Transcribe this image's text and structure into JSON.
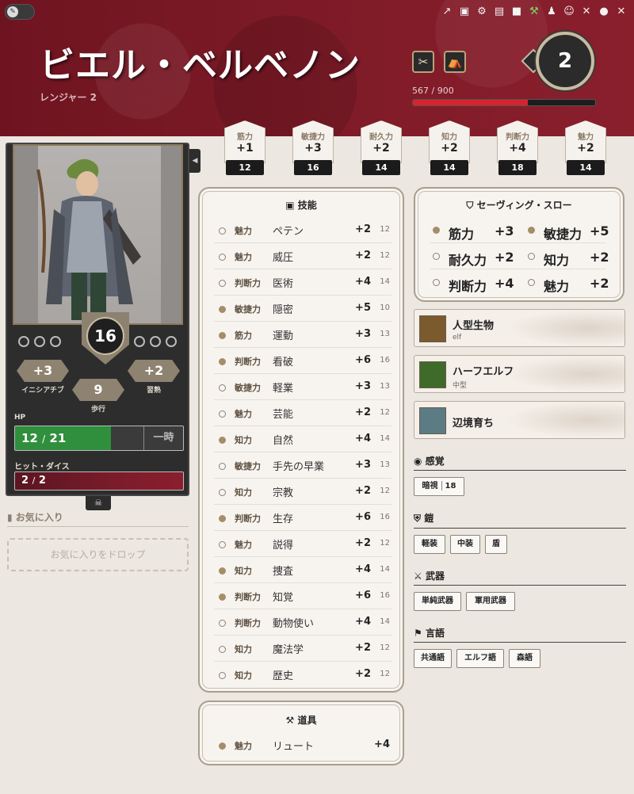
{
  "header": {
    "name": "ビエル・ベルベノン",
    "subclass": "レンジャー 2",
    "xp_text": "567 / 900",
    "xp_fraction": 0.63,
    "level": "2",
    "icons": [
      "external-link-icon",
      "portrait-icon",
      "gear-icon",
      "sheet-icon",
      "chat-icon",
      "wrench-icon",
      "user-edit-icon",
      "mask-icon",
      "tools-icon",
      "account-icon",
      "close-icon"
    ],
    "rest_icons": [
      "short-rest-icon",
      "long-rest-icon"
    ]
  },
  "abilities": [
    {
      "abbr": "筋力",
      "mod": "+1",
      "score": "12"
    },
    {
      "abbr": "敏捷力",
      "mod": "+3",
      "score": "16"
    },
    {
      "abbr": "耐久力",
      "mod": "+2",
      "score": "14"
    },
    {
      "abbr": "知力",
      "mod": "+2",
      "score": "14"
    },
    {
      "abbr": "判断力",
      "mod": "+4",
      "score": "18"
    },
    {
      "abbr": "魅力",
      "mod": "+2",
      "score": "14"
    }
  ],
  "sidebar": {
    "ac": "16",
    "initiative": {
      "value": "+3",
      "label": "イニシアチブ"
    },
    "proficiency": {
      "value": "+2",
      "label": "習熟"
    },
    "speed": {
      "value": "9",
      "label": "歩行"
    },
    "hp": {
      "label": "HP",
      "value": "12",
      "max": "21",
      "temp_label": "一時",
      "fraction": 0.571
    },
    "hit_dice": {
      "label": "ヒット・ダイス",
      "value": "2",
      "max": "2"
    },
    "favorites": {
      "title": "お気に入り",
      "drop": "お気に入りをドロップ"
    }
  },
  "skills": {
    "title": "技能",
    "rows": [
      {
        "abil": "魅力",
        "name": "ペテン",
        "mod": "+2",
        "passive": "12",
        "prof": false
      },
      {
        "abil": "魅力",
        "name": "威圧",
        "mod": "+2",
        "passive": "12",
        "prof": false
      },
      {
        "abil": "判断力",
        "name": "医術",
        "mod": "+4",
        "passive": "14",
        "prof": false
      },
      {
        "abil": "敏捷力",
        "name": "隠密",
        "mod": "+5",
        "passive": "10",
        "prof": true
      },
      {
        "abil": "筋力",
        "name": "運動",
        "mod": "+3",
        "passive": "13",
        "prof": true
      },
      {
        "abil": "判断力",
        "name": "看破",
        "mod": "+6",
        "passive": "16",
        "prof": true
      },
      {
        "abil": "敏捷力",
        "name": "軽業",
        "mod": "+3",
        "passive": "13",
        "prof": false
      },
      {
        "abil": "魅力",
        "name": "芸能",
        "mod": "+2",
        "passive": "12",
        "prof": false
      },
      {
        "abil": "知力",
        "name": "自然",
        "mod": "+4",
        "passive": "14",
        "prof": true
      },
      {
        "abil": "敏捷力",
        "name": "手先の早業",
        "mod": "+3",
        "passive": "13",
        "prof": false
      },
      {
        "abil": "知力",
        "name": "宗教",
        "mod": "+2",
        "passive": "12",
        "prof": false
      },
      {
        "abil": "判断力",
        "name": "生存",
        "mod": "+6",
        "passive": "16",
        "prof": true
      },
      {
        "abil": "魅力",
        "name": "説得",
        "mod": "+2",
        "passive": "12",
        "prof": false
      },
      {
        "abil": "知力",
        "name": "捜査",
        "mod": "+4",
        "passive": "14",
        "prof": true
      },
      {
        "abil": "判断力",
        "name": "知覚",
        "mod": "+6",
        "passive": "16",
        "prof": true
      },
      {
        "abil": "判断力",
        "name": "動物使い",
        "mod": "+4",
        "passive": "14",
        "prof": false
      },
      {
        "abil": "知力",
        "name": "魔法学",
        "mod": "+2",
        "passive": "12",
        "prof": false
      },
      {
        "abil": "知力",
        "name": "歴史",
        "mod": "+2",
        "passive": "12",
        "prof": false
      }
    ]
  },
  "tools": {
    "title": "道具",
    "rows": [
      {
        "abil": "魅力",
        "name": "リュート",
        "mod": "+4",
        "prof": true
      }
    ]
  },
  "saves": {
    "title": "セーヴィング・スロー",
    "items": [
      {
        "label": "筋力",
        "value": "+3",
        "prof": true
      },
      {
        "label": "敏捷力",
        "value": "+5",
        "prof": true
      },
      {
        "label": "耐久力",
        "value": "+2",
        "prof": false
      },
      {
        "label": "知力",
        "value": "+2",
        "prof": false
      },
      {
        "label": "判断力",
        "value": "+4",
        "prof": false
      },
      {
        "label": "魅力",
        "value": "+2",
        "prof": false
      }
    ]
  },
  "features": [
    {
      "title": "人型生物",
      "sub": "elf"
    },
    {
      "title": "ハーフエルフ",
      "sub": "中型"
    },
    {
      "title": "辺境育ち",
      "sub": ""
    }
  ],
  "senses": {
    "title": "感覚",
    "items": [
      {
        "label": "暗視",
        "value": "18"
      }
    ]
  },
  "armor": {
    "title": "鎧",
    "items": [
      "軽装",
      "中装",
      "盾"
    ]
  },
  "weapons": {
    "title": "武器",
    "items": [
      "単純武器",
      "軍用武器"
    ]
  },
  "languages": {
    "title": "言語",
    "items": [
      "共通語",
      "エルフ語",
      "森語"
    ]
  },
  "colors": {
    "header": "#7d1a27",
    "xp": "#d7232e",
    "hp": "#2f8f3d",
    "proficient_dot": "#a48e6a"
  }
}
